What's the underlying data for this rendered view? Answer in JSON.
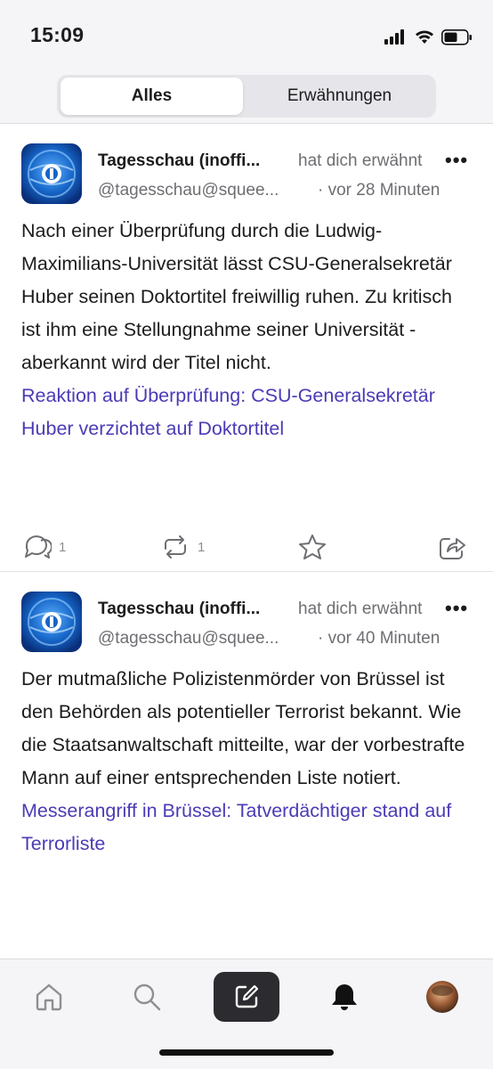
{
  "status": {
    "time": "15:09"
  },
  "tabs": {
    "all": "Alles",
    "mentions": "Erwähnungen"
  },
  "posts": [
    {
      "author": "Tagesschau (inoffi...",
      "handle": "@tagesschau@squee...",
      "mention": "hat dich erwähnt",
      "more": "•••",
      "time": "· vor 28 Minuten",
      "text": "Nach einer Überprüfung durch die Ludwig-Maximilians-Universität lässt CSU-Generalsekretär Huber seinen Doktortitel freiwillig ruhen. Zu kritisch ist ihm eine Stellungnahme seiner Universität - aberkannt wird der Titel nicht.",
      "link": "Reaktion auf Überprüfung: CSU-Generalsekretär Huber verzichtet auf Doktortitel",
      "replies": "1",
      "boosts": "1"
    },
    {
      "author": "Tagesschau (inoffi...",
      "handle": "@tagesschau@squee...",
      "mention": "hat dich erwähnt",
      "more": "•••",
      "time": "· vor 40 Minuten",
      "text": "Der mutmaßliche Polizistenmörder von Brüssel ist den Behörden als potentieller Terrorist bekannt. Wie die Staatsanwaltschaft mitteilte, war der vorbestrafte Mann auf einer entsprechenden Liste notiert.",
      "link": "Messerangriff in Brüssel: Tatverdächtiger stand auf Terrorliste",
      "replies": "",
      "boosts": ""
    }
  ],
  "nav": {
    "items": [
      "home-icon",
      "search-icon",
      "compose-icon",
      "notifications-icon",
      "profile-avatar"
    ],
    "active": "notifications-icon"
  },
  "colors": {
    "link": "#4a3bb5",
    "accent": "#2c2c30",
    "meta": "#6e6e73"
  }
}
